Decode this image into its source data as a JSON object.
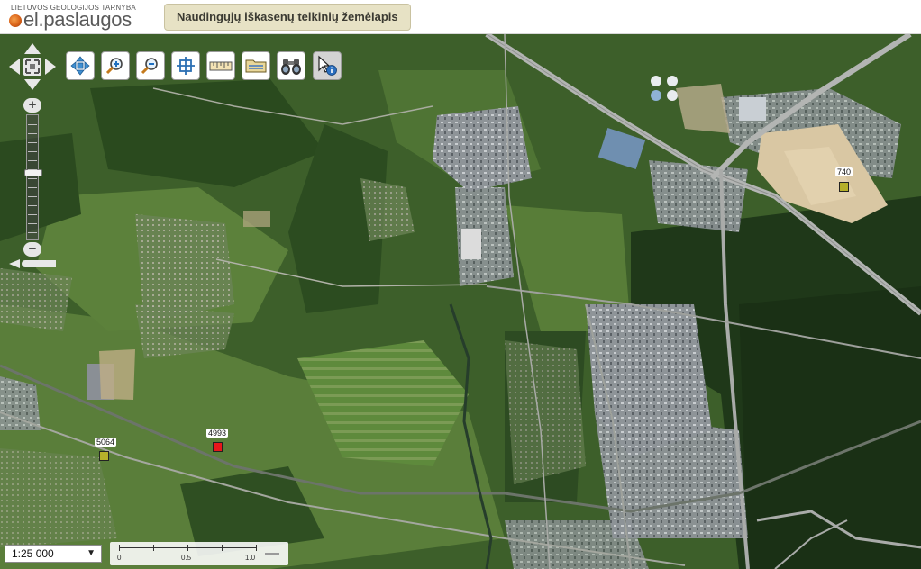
{
  "header": {
    "logo": {
      "agency_text": "LIETUVOS GEOLOGIJOS TARNYBA",
      "brand_text": "el.paslaugos"
    },
    "title_tab": "Naudingųjų iškasenų telkinių žemėlapis"
  },
  "map": {
    "imagery": "satellite",
    "pan_control": [
      "pan-up-icon",
      "pan-down-icon",
      "pan-left-icon",
      "pan-right-icon",
      "zoom-extent-icon"
    ],
    "zoom_slider": {
      "in_label": "+",
      "out_label": "−"
    },
    "toolbar": [
      {
        "name": "pan-tool",
        "icon": "move-arrows-icon",
        "active": false
      },
      {
        "name": "zoom-in-tool",
        "icon": "magnifier-plus-icon",
        "active": false
      },
      {
        "name": "zoom-out-tool",
        "icon": "magnifier-minus-icon",
        "active": false
      },
      {
        "name": "full-extent-tool",
        "icon": "crosshair-extent-icon",
        "active": false
      },
      {
        "name": "measure-tool",
        "icon": "ruler-icon",
        "active": false
      },
      {
        "name": "layers-tool",
        "icon": "folder-layers-icon",
        "active": false
      },
      {
        "name": "search-tool",
        "icon": "binoculars-icon",
        "active": false
      },
      {
        "name": "identify-tool",
        "icon": "cursor-info-icon",
        "active": true
      }
    ],
    "markers": [
      {
        "label": "740",
        "color": "#b5b02a"
      },
      {
        "label": "4993",
        "color": "#e8171b"
      },
      {
        "label": "5064",
        "color": "#b5b02a"
      }
    ],
    "scale": {
      "selected": "1:25 000",
      "bar_labels": [
        "0",
        "0.5",
        "1.0"
      ]
    }
  }
}
